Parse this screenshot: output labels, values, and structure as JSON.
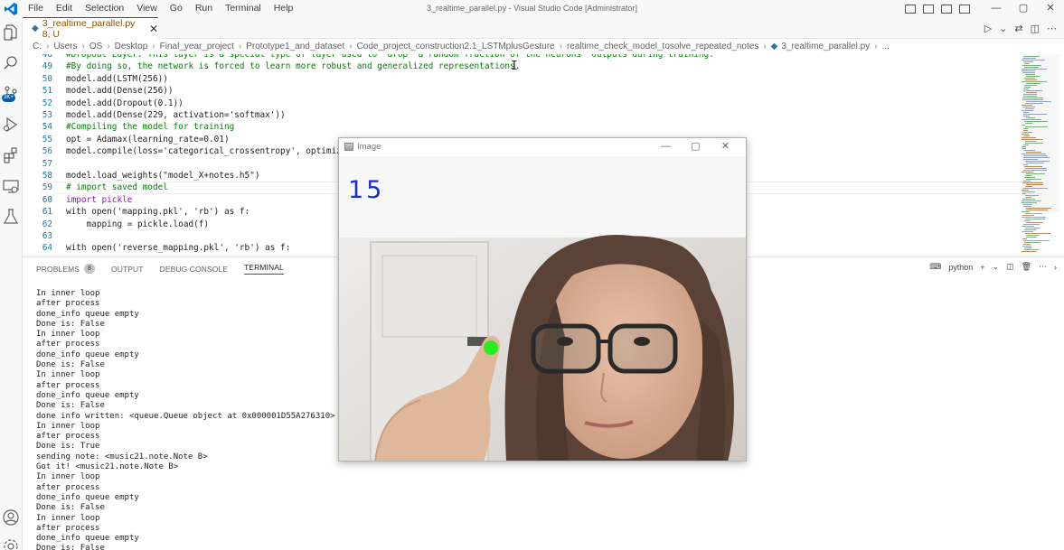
{
  "titlebar": {
    "menu": [
      "File",
      "Edit",
      "Selection",
      "View",
      "Go",
      "Run",
      "Terminal",
      "Help"
    ],
    "window_title": "3_realtime_parallel.py - Visual Studio Code [Administrator]",
    "controls": {
      "minimize": "—",
      "maximize": "▢",
      "close": "✕"
    }
  },
  "activitybar": {
    "icons": [
      "explorer-icon",
      "search-icon",
      "source-control-icon",
      "run-debug-icon",
      "extensions-icon",
      "remote-explorer-icon",
      "testing-icon",
      "account-icon",
      "settings-gear-icon"
    ],
    "badge": "3K+"
  },
  "tab": {
    "label": "3_realtime_parallel.py 8, U",
    "close": "✕"
  },
  "tab_actions": [
    "▷",
    "⌄",
    "⇄",
    "◫",
    "⋯"
  ],
  "breadcrumb": [
    "C:",
    "Users",
    "OS",
    "Desktop",
    "Final_year_project",
    "Prototype1_and_dataset",
    "Code_project_construction2.1_LSTMplusGesture",
    "realtime_check_model_tosolve_repeated_notes",
    "3_realtime_parallel.py",
    "..."
  ],
  "editor": {
    "lines": [
      {
        "n": "48",
        "t": "#Dropout Layer: This layer is a special type of layer used to \"drop\" a random fraction of the neurons' outputs during training.",
        "k": "cm"
      },
      {
        "n": "49",
        "t": "#By doing so, the network is forced to learn more robust and generalized representations.",
        "k": "cm"
      },
      {
        "n": "50",
        "t": "model.add(LSTM(256))",
        "k": "code"
      },
      {
        "n": "51",
        "t": "model.add(Dense(256))",
        "k": "code"
      },
      {
        "n": "52",
        "t": "model.add(Dropout(0.1))",
        "k": "code"
      },
      {
        "n": "53",
        "t": "model.add(Dense(229, activation='softmax'))",
        "k": "code"
      },
      {
        "n": "54",
        "t": "#Compiling the model for training",
        "k": "cm"
      },
      {
        "n": "55",
        "t": "opt = Adamax(learning_rate=0.01)",
        "k": "code"
      },
      {
        "n": "56",
        "t": "model.compile(loss='categorical_crossentropy', optimizer",
        "k": "code"
      },
      {
        "n": "57",
        "t": "",
        "k": "code"
      },
      {
        "n": "58",
        "t": "model.load_weights(\"model_X+notes.h5\")",
        "k": "code"
      },
      {
        "n": "59",
        "t": "# import saved model",
        "k": "cm"
      },
      {
        "n": "60",
        "t": "import pickle",
        "k": "kw"
      },
      {
        "n": "61",
        "t": "with open('mapping.pkl', 'rb') as f:",
        "k": "code"
      },
      {
        "n": "62",
        "t": "    mapping = pickle.load(f)",
        "k": "code"
      },
      {
        "n": "63",
        "t": "",
        "k": "code"
      },
      {
        "n": "64",
        "t": "with open('reverse_mapping.pkl', 'rb') as f:",
        "k": "code"
      }
    ]
  },
  "panel": {
    "tabs": [
      {
        "label": "PROBLEMS",
        "badge": "8"
      },
      {
        "label": "OUTPUT"
      },
      {
        "label": "DEBUG CONSOLE"
      },
      {
        "label": "TERMINAL",
        "active": true
      }
    ],
    "shell": "python",
    "terminal_lines": [
      "In inner loop",
      "after process",
      "done_info queue empty",
      "Done is: False",
      "In inner loop",
      "after process",
      "done_info queue empty",
      "Done is: False",
      "In inner loop",
      "after process",
      "done_info queue empty",
      "Done is: False",
      "done info written: <queue.Queue object at 0x000001D55A276310>",
      "In inner loop",
      "after process",
      "Done is: True",
      "sending note: <music21.note.Note B>",
      "Got it! <music21.note.Note B>",
      "In inner loop",
      "after process",
      "done_info queue empty",
      "Done is: False",
      "In inner loop",
      "after process",
      "done_info queue empty",
      "Done is: False"
    ]
  },
  "image_window": {
    "title": "Image",
    "counter": "15",
    "controls": {
      "minimize": "—",
      "maximize": "▢",
      "close": "✕"
    }
  },
  "colors": {
    "accent": "#005fb8",
    "counter_text": "#1a2ecc",
    "fingertip_marker": "#22ee22"
  }
}
